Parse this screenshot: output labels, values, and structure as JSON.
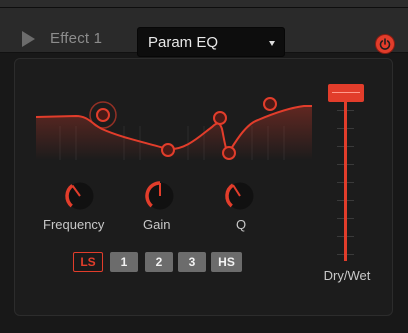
{
  "header": {
    "slot_title": "Effect 1",
    "effect_selected": "Param EQ",
    "power_on": true
  },
  "eq": {
    "knobs": [
      {
        "label": "Frequency"
      },
      {
        "label": "Gain"
      },
      {
        "label": "Q"
      }
    ],
    "bands": [
      {
        "label": "LS",
        "active": true
      },
      {
        "label": "1",
        "active": false
      },
      {
        "label": "2",
        "active": false
      },
      {
        "label": "3",
        "active": false
      },
      {
        "label": "HS",
        "active": false
      }
    ]
  },
  "dry_wet": {
    "label": "Dry/Wet",
    "value": 1.0
  },
  "colors": {
    "accent": "#e23d2b",
    "band_button": "#6c6c6c",
    "panel": "#1c1c1c"
  },
  "icons": {
    "play": "play-icon",
    "dropdown": "chevron-down-icon",
    "power": "power-icon"
  }
}
